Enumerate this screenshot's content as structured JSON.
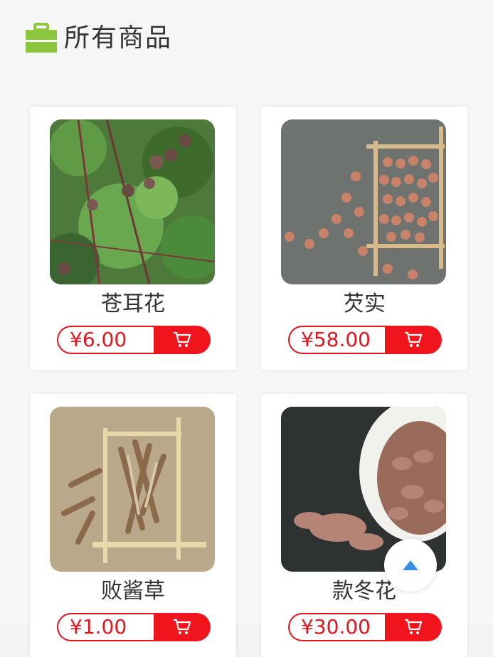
{
  "header": {
    "title": "所有商品",
    "icon": "briefcase-icon",
    "icon_color": "#8cc63f"
  },
  "products": [
    {
      "name": "苍耳花",
      "price": "¥6.00",
      "image": "cocklebur-plant-photo"
    },
    {
      "name": "芡实",
      "price": "¥58.00",
      "image": "gorgon-seeds-photo"
    },
    {
      "name": "败酱草",
      "price": "¥1.00",
      "image": "patrinia-herb-photo"
    },
    {
      "name": "款冬花",
      "price": "¥30.00",
      "image": "coltsfoot-flower-photo"
    }
  ],
  "colors": {
    "accent_red": "#f0141c",
    "background": "#f7f7f7"
  },
  "scroll_top": {
    "icon": "arrow-up-icon",
    "color": "#3a8ee6"
  }
}
